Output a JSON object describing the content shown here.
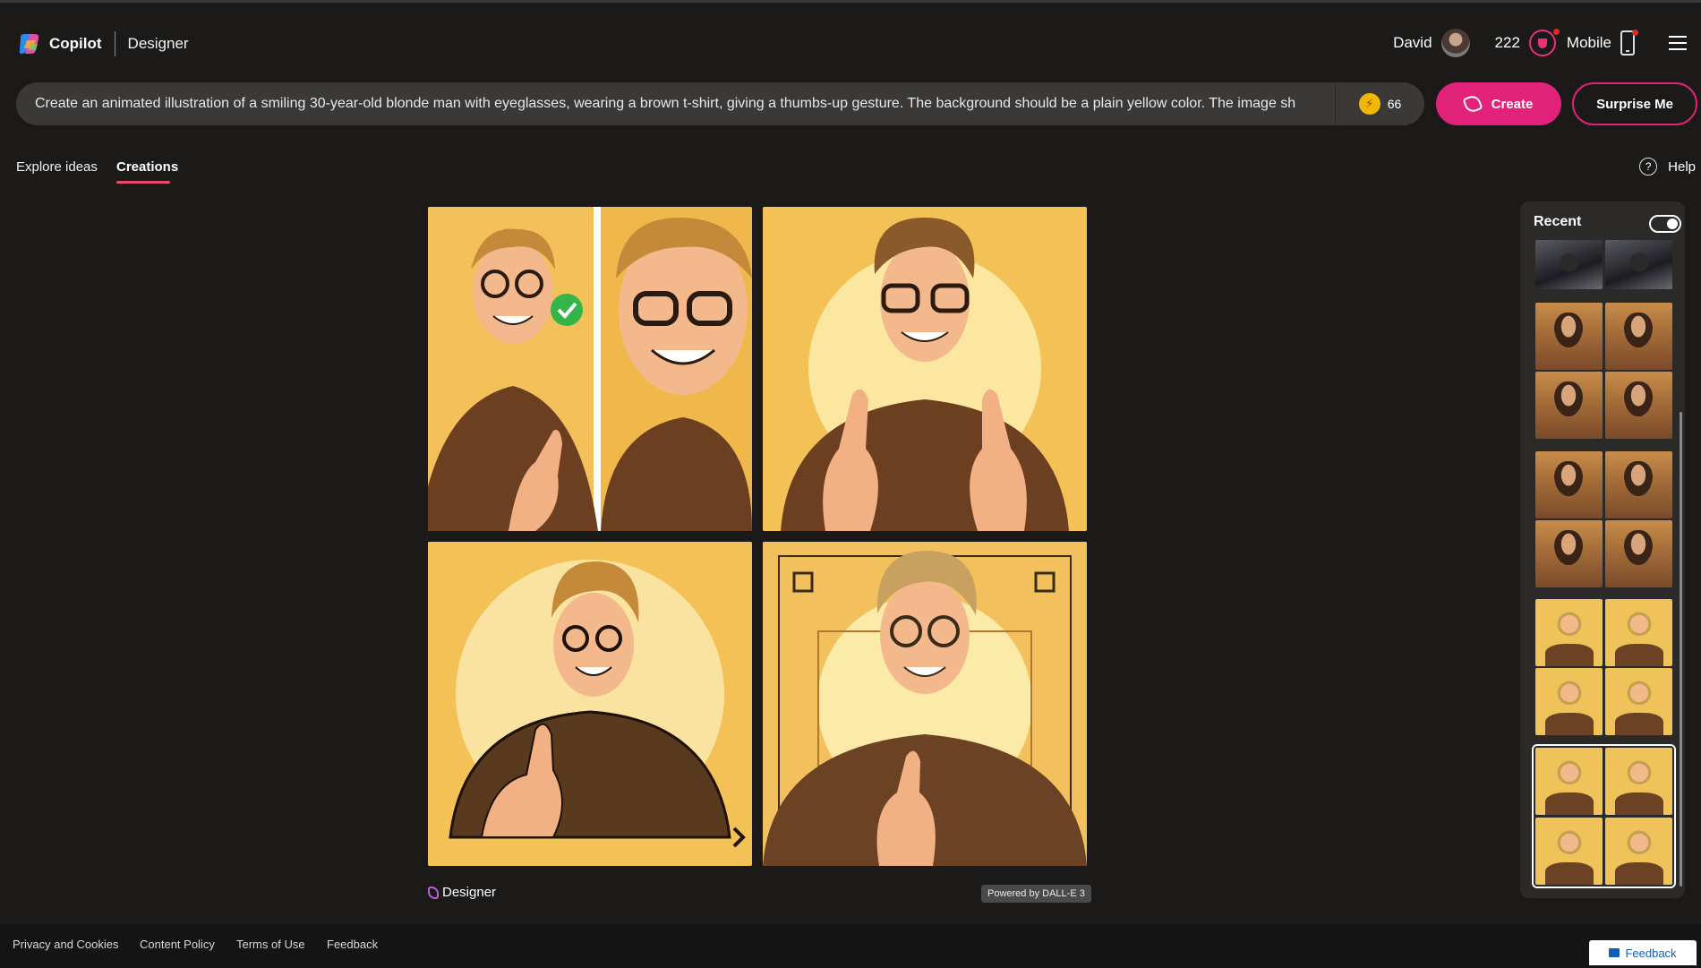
{
  "header": {
    "brand": "Copilot",
    "app_name": "Designer",
    "user_name": "David",
    "points": "222",
    "mobile_label": "Mobile"
  },
  "prompt": {
    "text": "Create an animated illustration of a smiling 30-year-old blonde man with eyeglasses, wearing a brown t-shirt, giving a thumbs-up gesture. The background should be a plain yellow color. The image sh",
    "boosts": "66"
  },
  "buttons": {
    "create": "Create",
    "surprise": "Surprise Me"
  },
  "tabs": {
    "explore": "Explore ideas",
    "creations": "Creations"
  },
  "help_label": "Help",
  "image_footer": {
    "designer": "Designer",
    "powered_by": "Powered by DALL-E 3"
  },
  "recent": {
    "title": "Recent",
    "toggle_on": true
  },
  "footer": {
    "links": [
      "Privacy and Cookies",
      "Content Policy",
      "Terms of Use",
      "Feedback"
    ],
    "feedback_button": "Feedback"
  },
  "colors": {
    "background": "#1b1a19",
    "accent": "#e2227a",
    "prompt_bg": "#3a3938",
    "image_bg": "#f4c157"
  }
}
